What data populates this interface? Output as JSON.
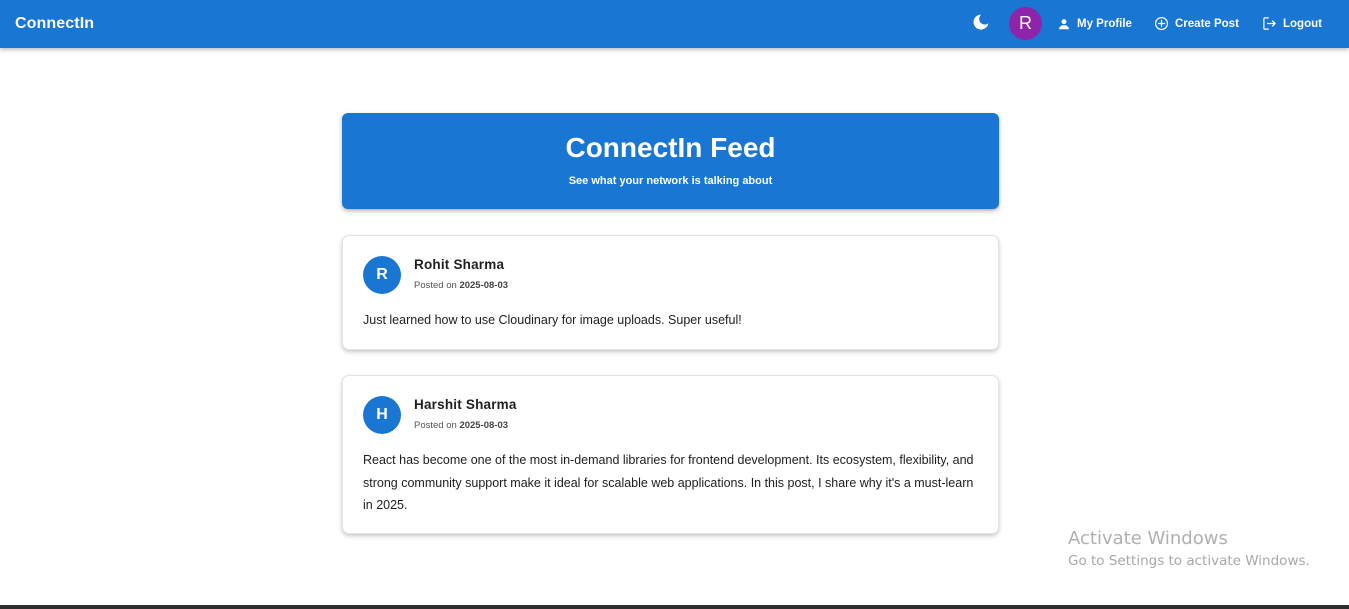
{
  "appbar": {
    "brand": "ConnectIn",
    "avatar_initial": "R",
    "my_profile_label": "My Profile",
    "create_post_label": "Create Post",
    "logout_label": "Logout",
    "icons": [
      "moon-icon",
      "person-icon",
      "add-circle-icon",
      "logout-icon"
    ]
  },
  "feed": {
    "title": "ConnectIn Feed",
    "subtitle": "See what your network is talking about"
  },
  "posts": [
    {
      "initial": "R",
      "author": "Rohit Sharma",
      "posted_on_label": "Posted on",
      "date": "2025-08-03",
      "content": "Just learned how to use Cloudinary for image uploads. Super useful!"
    },
    {
      "initial": "H",
      "author": "Harshit Sharma",
      "posted_on_label": "Posted on",
      "date": "2025-08-03",
      "content": "React has become one of the most in-demand libraries for frontend development. Its ecosystem, flexibility, and strong community support make it ideal for scalable web applications. In this post, I share why it's a must-learn in 2025."
    }
  ],
  "watermark": {
    "title": "Activate Windows",
    "subtitle": "Go to Settings to activate Windows."
  },
  "colors": {
    "primary": "#1976d2",
    "avatar_accent": "#8e24aa"
  }
}
